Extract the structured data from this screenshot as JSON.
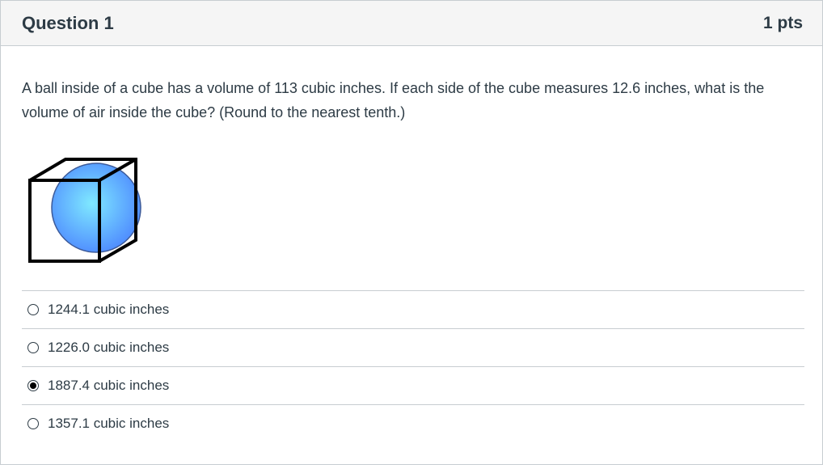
{
  "question": {
    "title": "Question 1",
    "points": "1 pts",
    "text": "A ball inside of a cube has a volume of 113 cubic inches. If each side of the cube measures 12.6 inches, what is the volume of air inside the cube? (Round to the nearest tenth.)",
    "figure_icon": "ball-inside-cube",
    "figure_colors": {
      "ball_center": "#7fe9ff",
      "ball_edge": "#4d88ff",
      "outline": "#000000"
    },
    "answers": [
      {
        "label": "1244.1 cubic inches",
        "selected": false
      },
      {
        "label": "1226.0 cubic inches",
        "selected": false
      },
      {
        "label": "1887.4 cubic inches",
        "selected": true
      },
      {
        "label": "1357.1 cubic inches",
        "selected": false
      }
    ]
  }
}
